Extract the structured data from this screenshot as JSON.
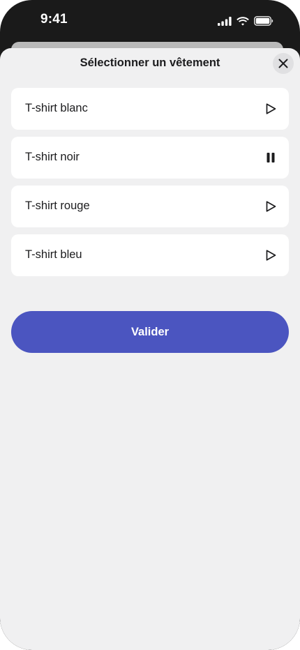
{
  "status_bar": {
    "time": "9:41",
    "icons": [
      "signal-icon",
      "wifi-icon",
      "battery-icon"
    ]
  },
  "sheet": {
    "title": "Sélectionner un vêtement",
    "close_icon": "close-icon"
  },
  "items": [
    {
      "label": "T-shirt blanc",
      "state": "paused",
      "action_icon": "play-icon"
    },
    {
      "label": "T-shirt noir",
      "state": "playing",
      "action_icon": "pause-icon"
    },
    {
      "label": "T-shirt rouge",
      "state": "paused",
      "action_icon": "play-icon"
    },
    {
      "label": "T-shirt bleu",
      "state": "paused",
      "action_icon": "play-icon"
    }
  ],
  "validate_label": "Valider",
  "colors": {
    "accent": "#4b55c0",
    "sheet_background": "#f0f0f1",
    "card_background": "#ffffff",
    "text": "#1c1c1e"
  }
}
